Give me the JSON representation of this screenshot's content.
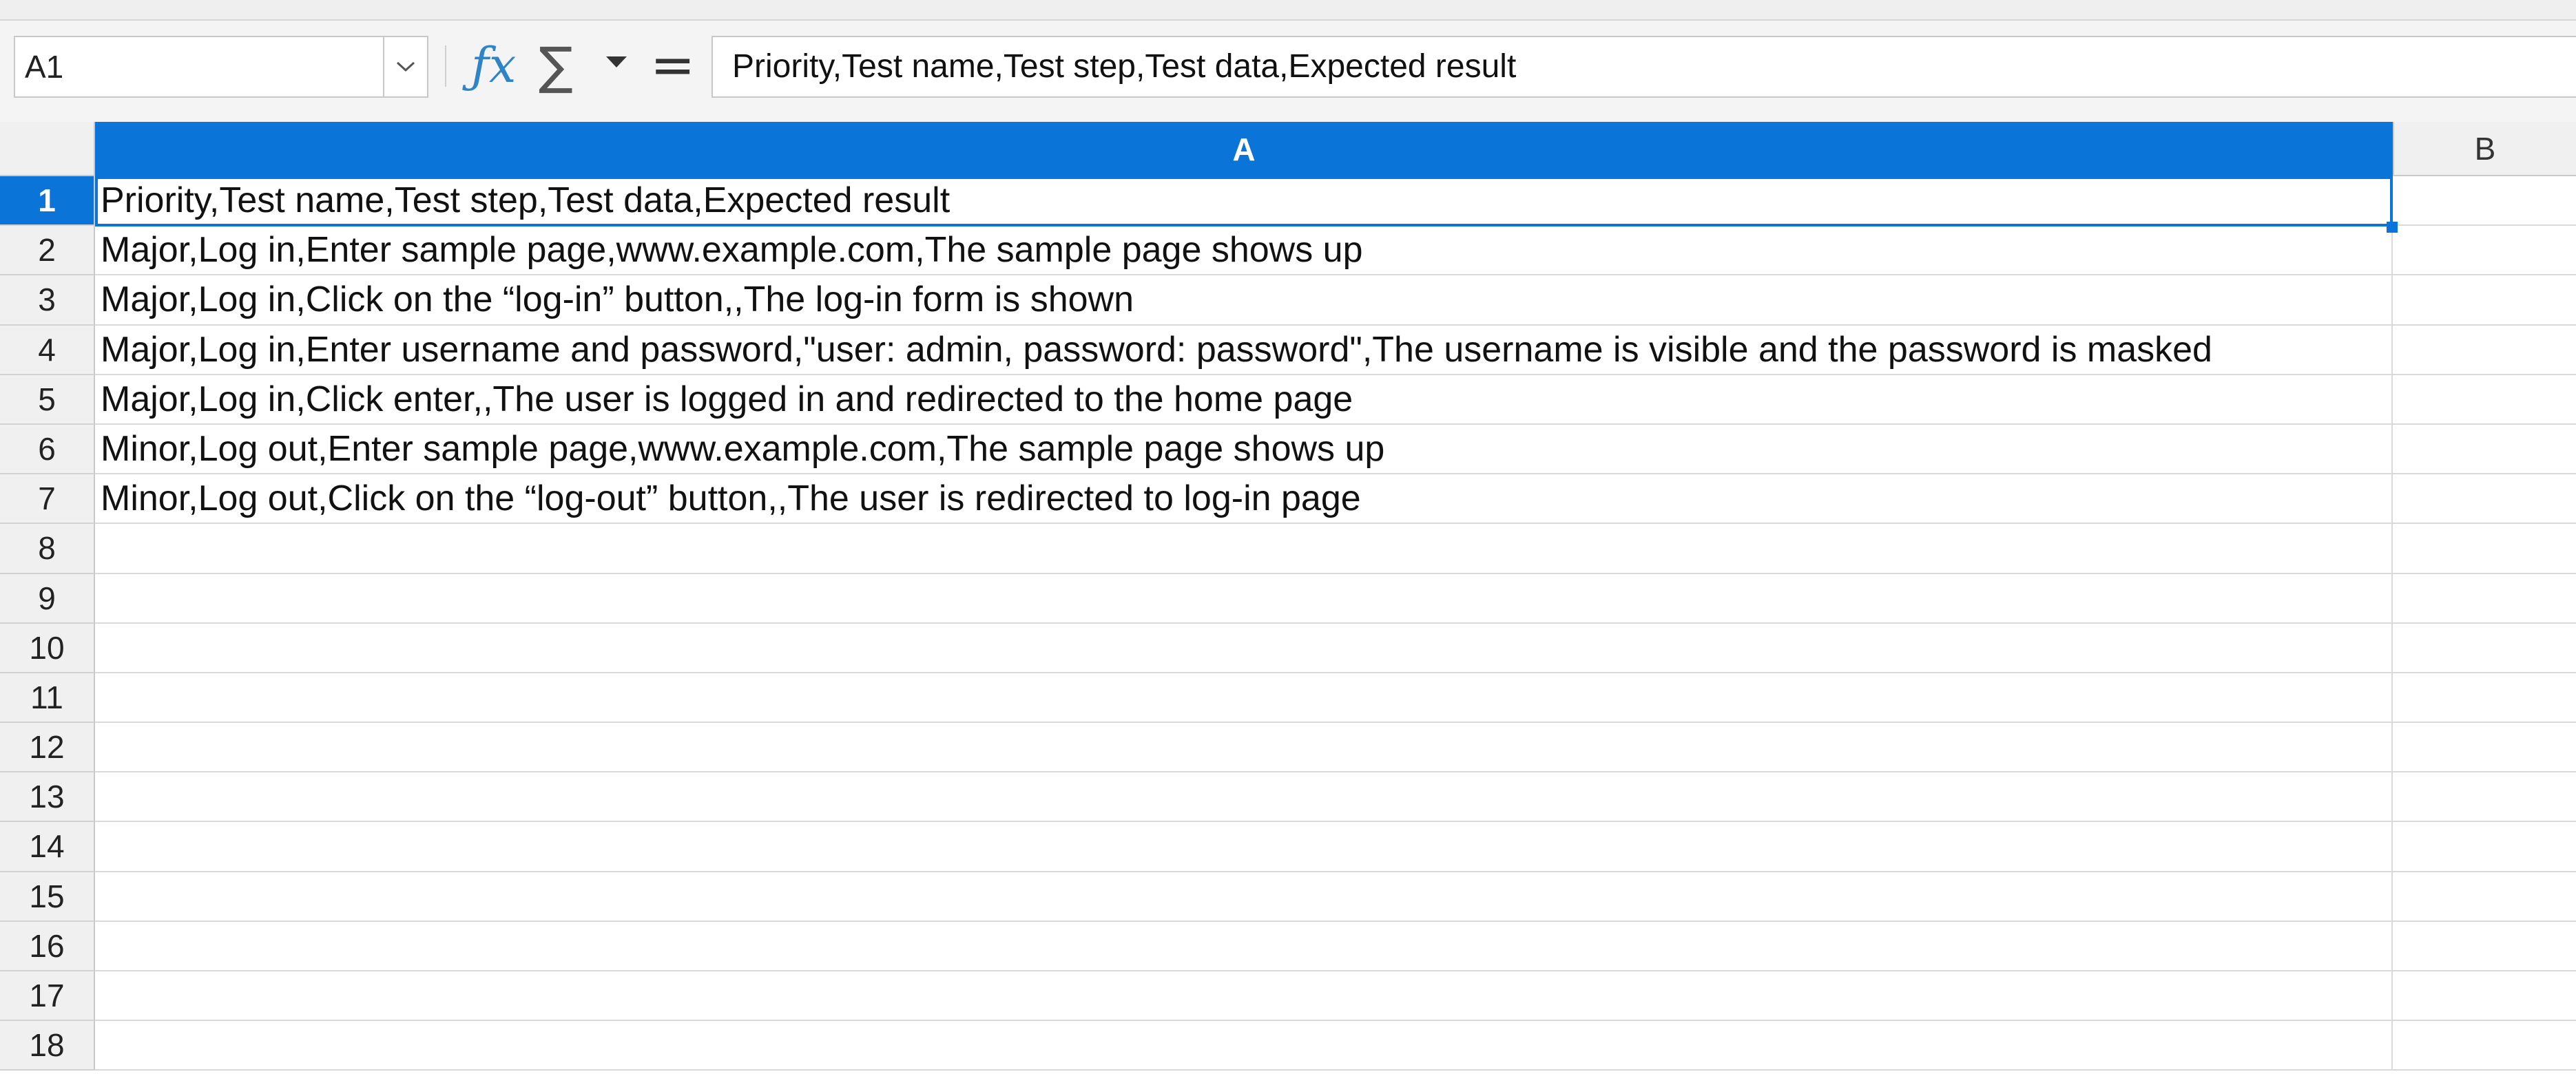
{
  "formula_bar": {
    "cell_reference": "A1",
    "formula_text": "Priority,Test name,Test step,Test data,Expected result"
  },
  "columns": [
    "A",
    "B"
  ],
  "active_cell": "A1",
  "rows": [
    {
      "num": "1",
      "a": "Priority,Test name,Test step,Test data,Expected result"
    },
    {
      "num": "2",
      "a": "Major,Log in,Enter sample page,www.example.com,The sample page shows up"
    },
    {
      "num": "3",
      "a": "Major,Log in,Click on the “log-in” button,,The log-in form is shown"
    },
    {
      "num": "4",
      "a": "Major,Log in,Enter username and password,\"user: admin, password: password\",The username is visible and the password is masked"
    },
    {
      "num": "5",
      "a": "Major,Log in,Click enter,,The user is logged in and redirected to the home page"
    },
    {
      "num": "6",
      "a": "Minor,Log out,Enter sample page,www.example.com,The sample page shows up"
    },
    {
      "num": "7",
      "a": "Minor,Log out,Click on the “log-out” button,,The user is redirected to log-in page"
    },
    {
      "num": "8",
      "a": ""
    },
    {
      "num": "9",
      "a": ""
    },
    {
      "num": "10",
      "a": ""
    },
    {
      "num": "11",
      "a": ""
    },
    {
      "num": "12",
      "a": ""
    },
    {
      "num": "13",
      "a": ""
    },
    {
      "num": "14",
      "a": ""
    },
    {
      "num": "15",
      "a": ""
    },
    {
      "num": "16",
      "a": ""
    },
    {
      "num": "17",
      "a": ""
    },
    {
      "num": "18",
      "a": ""
    }
  ],
  "colors": {
    "accent": "#0a74d8",
    "function_icon": "#2f84c8"
  },
  "icons": {
    "function_wizard": "fx-icon",
    "sum": "sum-icon",
    "formula": "equals-icon",
    "name_box_dropdown": "chevron-down-icon"
  }
}
